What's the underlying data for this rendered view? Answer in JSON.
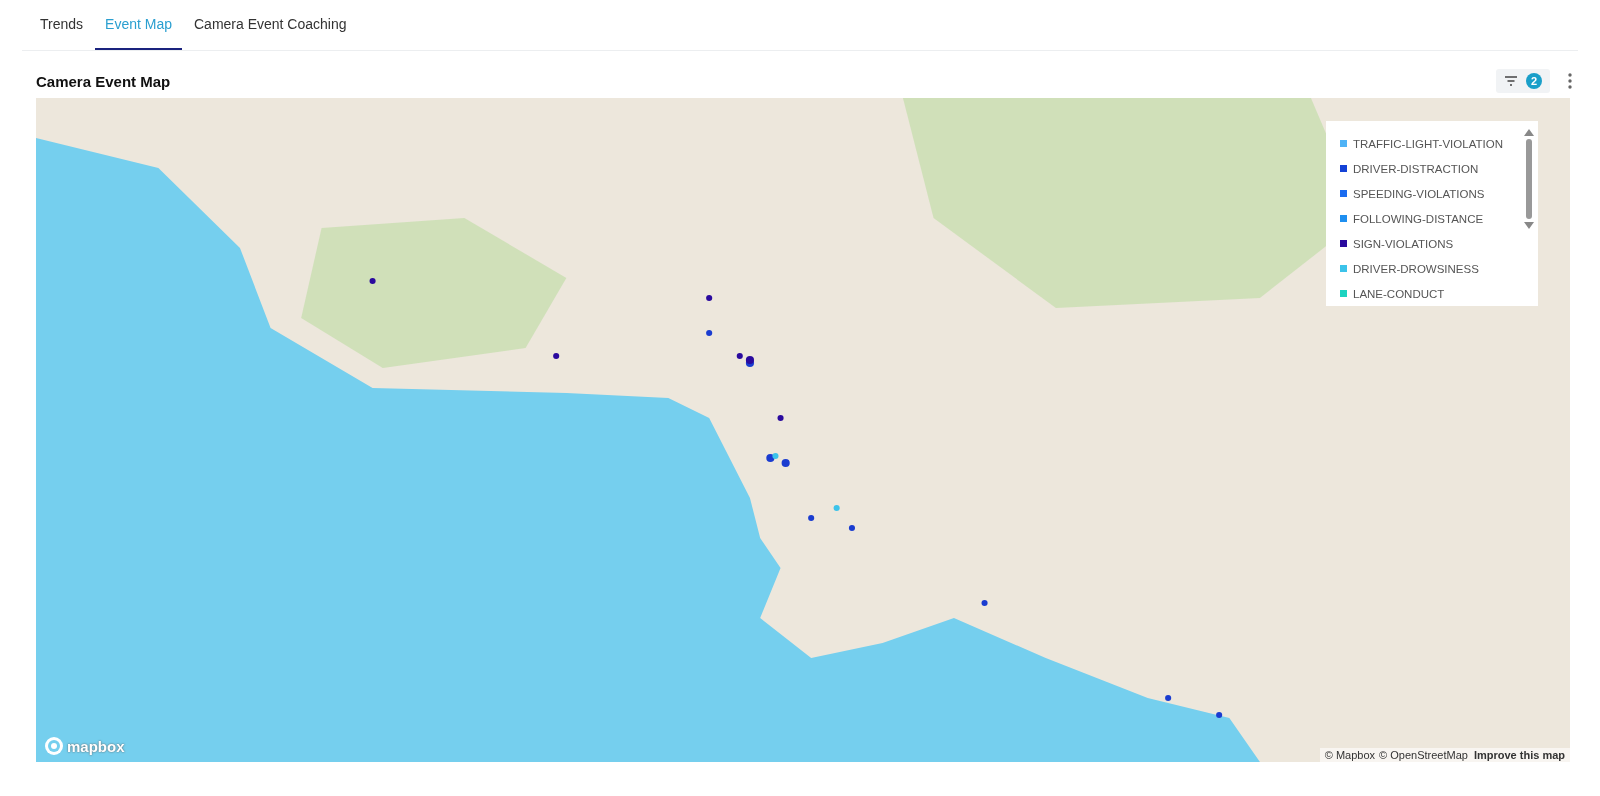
{
  "tabs": [
    {
      "label": "Trends",
      "selected": false
    },
    {
      "label": "Event Map",
      "selected": true
    },
    {
      "label": "Camera Event Coaching",
      "selected": false
    }
  ],
  "panel": {
    "title": "Camera Event Map",
    "filter_count": "2"
  },
  "legend": [
    {
      "label": "TRAFFIC-LIGHT-VIOLATION",
      "color": "#4fb3f6"
    },
    {
      "label": "DRIVER-DISTRACTION",
      "color": "#1442d6"
    },
    {
      "label": "SPEEDING-VIOLATIONS",
      "color": "#1a6cf0"
    },
    {
      "label": "FOLLOWING-DISTANCE",
      "color": "#1e8ff0"
    },
    {
      "label": "SIGN-VIOLATIONS",
      "color": "#2a0a9e"
    },
    {
      "label": "DRIVER-DROWSINESS",
      "color": "#3cc3ea"
    },
    {
      "label": "LANE-CONDUCT",
      "color": "#1dd3c0"
    }
  ],
  "map": {
    "logo": "mapbox",
    "attribution": [
      "© Mapbox",
      "© OpenStreetMap"
    ],
    "improve_link": "Improve this map"
  }
}
